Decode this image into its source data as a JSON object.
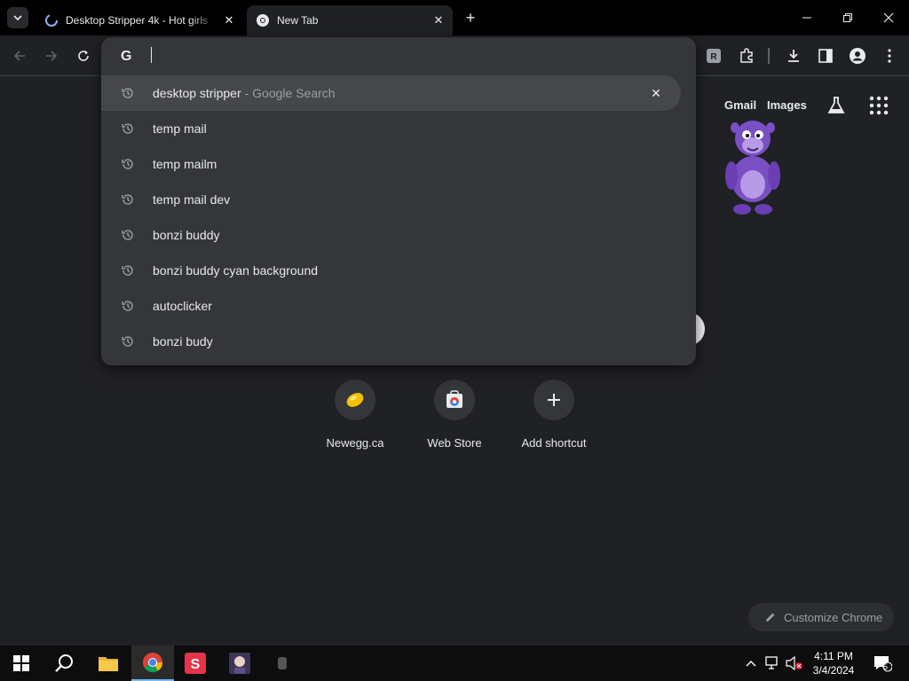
{
  "tabs": [
    {
      "title": "Desktop Stripper 4k - Hot girls",
      "active": false
    },
    {
      "title": "New Tab",
      "active": true
    }
  ],
  "omnibox": {
    "value": "",
    "suggestions": [
      {
        "text": "desktop stripper",
        "desc": "- Google Search",
        "selected": true
      },
      {
        "text": "temp mail"
      },
      {
        "text": "temp mailm"
      },
      {
        "text": "temp mail dev"
      },
      {
        "text": "bonzi buddy"
      },
      {
        "text": "bonzi buddy cyan background"
      },
      {
        "text": "autoclicker"
      },
      {
        "text": "bonzi budy"
      }
    ]
  },
  "ntp": {
    "links": {
      "gmail": "Gmail",
      "images": "Images"
    },
    "shortcuts": [
      {
        "label": "Newegg.ca"
      },
      {
        "label": "Web Store"
      },
      {
        "label": "Add shortcut"
      }
    ],
    "customize_label": "Customize Chrome"
  },
  "taskbar": {
    "time": "4:11 PM",
    "date": "3/4/2024",
    "notification_count": "5"
  },
  "colors": {
    "background": "#202124",
    "tabstrip": "#000000",
    "omnibox": "#35363a",
    "text": "#e8eaed",
    "muted": "#9aa0a6"
  }
}
